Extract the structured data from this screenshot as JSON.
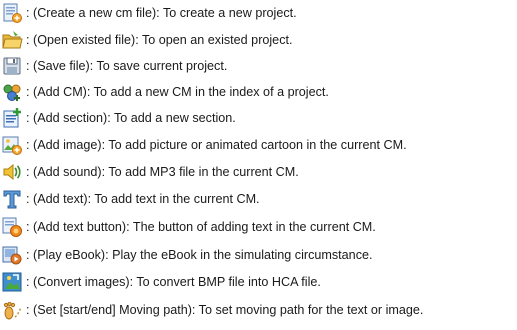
{
  "items": [
    {
      "icon": "new-file-icon",
      "text": ": (Create a new cm file): To create a new project."
    },
    {
      "icon": "open-folder-icon",
      "text": ": (Open existed file): To open an existed project."
    },
    {
      "icon": "save-floppy-icon",
      "text": ": (Save file): To save current project."
    },
    {
      "icon": "add-cm-icon",
      "text": ": (Add CM): To add a new CM in the index of a project."
    },
    {
      "icon": "add-section-icon",
      "text": ": (Add section): To add a new section."
    },
    {
      "icon": "add-image-icon",
      "text": ": (Add image): To add picture or animated cartoon in the current CM."
    },
    {
      "icon": "add-sound-icon",
      "text": ": (Add sound): To add MP3 file in the current CM."
    },
    {
      "icon": "add-text-icon",
      "text": ": (Add text): To add text in the current CM."
    },
    {
      "icon": "add-text-button-icon",
      "text": ": (Add text button): The button of adding text in the current CM."
    },
    {
      "icon": "play-ebook-icon",
      "text": ": (Play eBook): Play the eBook in the simulating circumstance."
    },
    {
      "icon": "convert-images-icon",
      "text": ": (Convert images): To convert BMP file into HCA file."
    },
    {
      "icon": "moving-path-icon",
      "text": ": (Set [start/end] Moving path): To set moving path for the text or image."
    }
  ]
}
